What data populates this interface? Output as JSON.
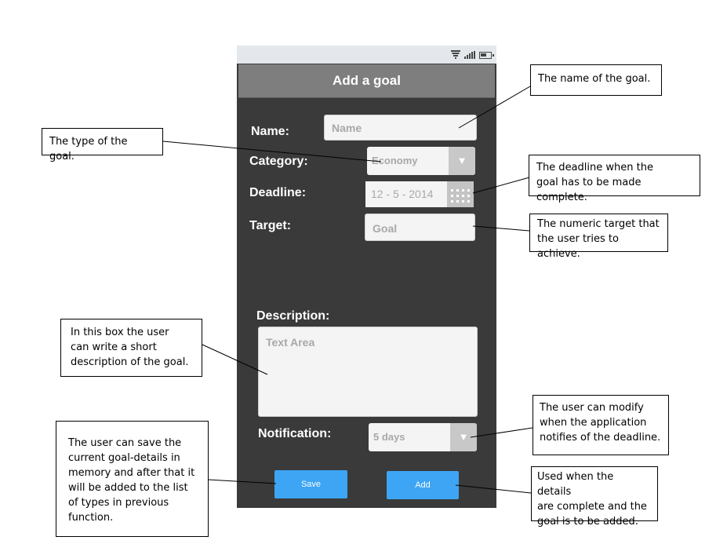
{
  "screen": {
    "title": "Add a goal",
    "form": {
      "name": {
        "label": "Name:",
        "placeholder": "Name"
      },
      "category": {
        "label": "Category:",
        "value": "Economy",
        "arrow": "▼"
      },
      "deadline": {
        "label": "Deadline:",
        "value": "12 - 5 - 2014",
        "icon": "calendar-icon"
      },
      "target": {
        "label": "Target:",
        "placeholder": "Goal"
      },
      "description": {
        "label": "Description:",
        "placeholder": "Text Area"
      },
      "notification": {
        "label": "Notification:",
        "value": "5 days",
        "arrow": "▼"
      }
    },
    "buttons": {
      "save": "Save",
      "add": "Add"
    },
    "status_icons": [
      "wifi-icon",
      "signal-icon",
      "battery-icon"
    ]
  },
  "callouts": {
    "name": "The name of the goal.",
    "category": "The type of the goal.",
    "deadline": "The deadline when the\ngoal has to be made complete.",
    "target": "The numeric target that\nthe user tries to achieve.",
    "description": "In this box the user\ncan write a short\ndescription of the goal.",
    "notification": "The user can modify\nwhen the application\nnotifies of the deadline.",
    "save": "The user can save the\ncurrent goal-details in\nmemory and after that it\nwill be added to the list\nof types in previous\nfunction.",
    "add": "Used when the details\nare complete and the\ngoal is to be added."
  },
  "colors": {
    "phone_bg": "#3a3a3a",
    "titlebar": "#7e7e7e",
    "button": "#3da5f4",
    "statusbar": "#e4e8ec"
  }
}
